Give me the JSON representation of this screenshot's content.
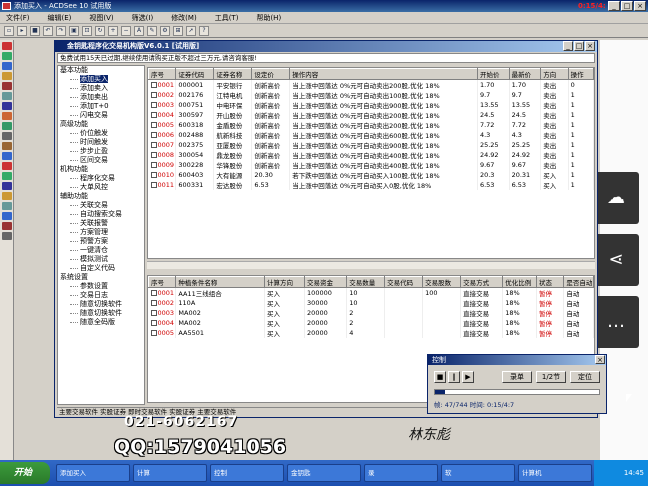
{
  "window": {
    "title": "添加买入 - ACDSee 10 试用版",
    "rec_time": "0:15/4:"
  },
  "menu": [
    "文件(F)",
    "编辑(E)",
    "视图(V)",
    "筛选(I)",
    "修改(M)",
    "工具(T)",
    "帮助(H)"
  ],
  "app": {
    "title": "金钥匙程序化交易机构版V6.0.1 [试用版]",
    "notice": "免费试用15天已过期,继续使用请购买正版不超过三万元,请咨询客服!",
    "status": "主要交易软件 实股证券 即时交易软件 实股证券 主要交易软件"
  },
  "tree": [
    {
      "group": "基本功能",
      "items": [
        "添加买入",
        "添加卖入",
        "添加卖出",
        "添加T+0",
        "闪电交易"
      ],
      "selected": 0
    },
    {
      "group": "高级功能",
      "items": [
        "价位触发",
        "时间触发",
        "步步止盈",
        "区间交易"
      ]
    },
    {
      "group": "机构功能",
      "items": [
        "程序化交易",
        "大单风控"
      ]
    },
    {
      "group": "辅助功能",
      "items": [
        "关联交易",
        "自动搜索交易",
        "关联报警",
        "方案管理",
        "预警方案",
        "一键清仓",
        "模拟测试",
        "自定义代码"
      ]
    },
    {
      "group": "系统设置",
      "items": [
        "参数设置",
        "交易日志",
        "随意切换软件",
        "随意切换软件",
        "随意全码版"
      ]
    }
  ],
  "orders": {
    "headers": [
      "序号",
      "证券代码",
      "证券名称",
      "设定价",
      "操作内容",
      "开始价",
      "最新价",
      "方向",
      "操作"
    ],
    "rows": [
      [
        "0001",
        "000001",
        "平安银行",
        "创新高价",
        "当上涨中回落达 0%元可自动卖出200股,优化 18%",
        "1.70",
        "1.70",
        "卖出",
        "0"
      ],
      [
        "0002",
        "002176",
        "江特电机",
        "创新高价",
        "当上涨中回落达 0%元可自动卖出100股,优化 18%",
        "9.7",
        "9.7",
        "卖出",
        "1"
      ],
      [
        "0003",
        "000751",
        "中电环保",
        "创新高价",
        "当上涨中回落达 0%元可自动卖出900股,优化 18%",
        "13.55",
        "13.55",
        "卖出",
        "1"
      ],
      [
        "0004",
        "300597",
        "开山股份",
        "创新高价",
        "当上涨中回落达 0%元可自动卖出200股,优化 18%",
        "24.5",
        "24.5",
        "卖出",
        "1"
      ],
      [
        "0005",
        "600318",
        "金盾股份",
        "创新高价",
        "当上涨中回落达 0%元可自动卖出200股,优化 18%",
        "7.72",
        "7.72",
        "卖出",
        "1"
      ],
      [
        "0006",
        "002488",
        "航新科技",
        "创新高价",
        "当上涨中回落达 0%元可自动卖出600股,优化 18%",
        "4.3",
        "4.3",
        "卖出",
        "1"
      ],
      [
        "0007",
        "002375",
        "亚厦股份",
        "创新高价",
        "当上涨中回落达 0%元可自动卖出900股,优化 18%",
        "25.25",
        "25.25",
        "卖出",
        "1"
      ],
      [
        "0008",
        "300054",
        "鼎龙股份",
        "创新高价",
        "当上涨中回落达 0%元可自动卖出400股,优化 18%",
        "24.92",
        "24.92",
        "卖出",
        "1"
      ],
      [
        "0009",
        "300228",
        "华锋股份",
        "创新高价",
        "当上涨中回落达 0%元可自动卖出400股,优化 18%",
        "9.67",
        "9.67",
        "卖出",
        "1"
      ],
      [
        "0010",
        "600403",
        "大有能源",
        "20.30",
        "若下跌中回落达 0%元可自动买入100股,优化 18%",
        "20.3",
        "20.31",
        "买入",
        "1"
      ],
      [
        "0011",
        "600331",
        "宏达股份",
        "6.53",
        "当上涨中回落达 0%元可自动买入0股,优化 18%",
        "6.53",
        "6.53",
        "买入",
        "1"
      ]
    ]
  },
  "strategies": {
    "headers": [
      "序号",
      "种植条件名称",
      "计算方向",
      "交易资金",
      "交易数量",
      "交易代码",
      "交易股数",
      "交易方式",
      "优化比例",
      "状态",
      "是否自动"
    ],
    "rows": [
      [
        "0001",
        "AA11三线组合",
        "买入",
        "100000",
        "10",
        "",
        "100",
        "直接交易",
        "18%",
        "暂停",
        "自动"
      ],
      [
        "0002",
        "110A",
        "买入",
        "30000",
        "10",
        "",
        "",
        "直接交易",
        "18%",
        "暂停",
        "自动"
      ],
      [
        "0003",
        "MA002",
        "买入",
        "20000",
        "2",
        "",
        "",
        "直接交易",
        "18%",
        "暂停",
        "自动"
      ],
      [
        "0004",
        "MA002",
        "买入",
        "20000",
        "2",
        "",
        "",
        "直接交易",
        "18%",
        "暂停",
        "自动"
      ],
      [
        "0005",
        "AA5501",
        "买入",
        "20000",
        "4",
        "",
        "",
        "直接交易",
        "18%",
        "暂停",
        "自动"
      ]
    ]
  },
  "player": {
    "title": "控制",
    "record_label": "录单",
    "page_label": "1/2节",
    "locate_label": "定位",
    "status": "帧: 47/744  时间: 0:15/4:7",
    "progress": 0.06
  },
  "watermark": {
    "phone": "021-6062167",
    "qq": "QQ:1579041056",
    "signature": "林东彪"
  },
  "taskbar": {
    "start": "开始",
    "tasks": [
      "添加买入",
      "计算",
      "控制",
      "金钥匙",
      "录",
      "软",
      "计算机"
    ],
    "clock": "14:45"
  }
}
